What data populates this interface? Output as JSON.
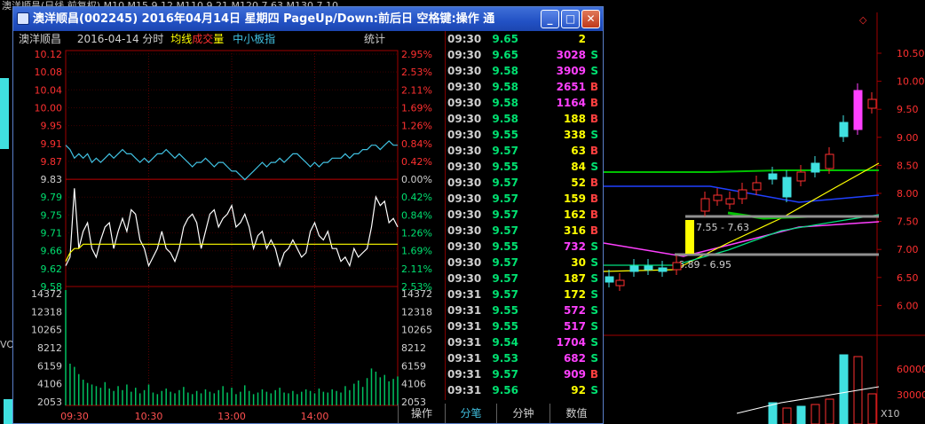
{
  "background_app": {
    "title_fragment": "澳洋顺昌(日线 前复权) M10  M15  9.12  M110  9.21  M120  7.63  M130  7.10",
    "vol_label": "VO",
    "price_axis": [
      "10.50",
      "10.00",
      "9.50",
      "9.00",
      "8.50",
      "8.00",
      "7.50",
      "7.00",
      "6.50",
      "6.00"
    ],
    "vol_axis": [
      "60000",
      "30000"
    ],
    "vol_scale": "X10",
    "annotation_high": "7.55 - 7.63",
    "annotation_low": "6.89 - 6.95",
    "diamond_icon": "diamond-icon"
  },
  "window": {
    "title": "澳洋顺昌(002245)  2016年04月14日  星期四  PageUp/Down:前后日  空格键:操作  通",
    "min_label": "_",
    "max_label": "□",
    "close_label": "✕"
  },
  "chart_header": {
    "stock_name": "澳洋顺昌",
    "date_label": "2016-04-14 分时",
    "avg_label": "均线",
    "volume_label": "成交量",
    "index_label": "中小板指",
    "stats_label": "统计"
  },
  "colors": {
    "up": "#ff3030",
    "down": "#00e070",
    "price_line": "#ffffff",
    "avg_line": "#ffff00",
    "index_line": "#40c0e0",
    "buy": "#ff4040",
    "sell": "#00e070",
    "neutral_volume": "#ffffff",
    "buy_volume_color": "#ff40ff"
  },
  "chart_data": {
    "type": "line",
    "title": "澳洋顺昌 2016-04-14 分时",
    "x_ticks": [
      "09:30",
      "10:30",
      "13:00",
      "14:00"
    ],
    "price_ticks": [
      "10.12",
      "10.08",
      "10.04",
      "10.00",
      "9.95",
      "9.91",
      "9.87",
      "9.83",
      "9.79",
      "9.75",
      "9.71",
      "9.66",
      "9.62",
      "9.58"
    ],
    "pct_ticks": [
      "2.95%",
      "2.53%",
      "2.11%",
      "1.69%",
      "1.26%",
      "0.84%",
      "0.42%",
      "0.00%",
      "0.42%",
      "0.84%",
      "1.26%",
      "1.69%",
      "2.11%",
      "2.53%"
    ],
    "prev_close": 9.83,
    "ylim": [
      9.58,
      10.12
    ],
    "volume_ticks": [
      "14372",
      "12318",
      "10265",
      "8212",
      "6159",
      "4106",
      "2053"
    ],
    "volume_ylim": [
      0,
      14372
    ],
    "series": [
      {
        "name": "价格",
        "color": "#ffffff",
        "values": [
          9.62,
          9.64,
          9.8,
          9.66,
          9.7,
          9.72,
          9.66,
          9.64,
          9.68,
          9.71,
          9.72,
          9.66,
          9.7,
          9.73,
          9.7,
          9.75,
          9.74,
          9.68,
          9.66,
          9.62,
          9.64,
          9.66,
          9.7,
          9.66,
          9.65,
          9.63,
          9.66,
          9.71,
          9.73,
          9.74,
          9.72,
          9.66,
          9.7,
          9.74,
          9.75,
          9.71,
          9.73,
          9.74,
          9.76,
          9.71,
          9.72,
          9.74,
          9.71,
          9.66,
          9.69,
          9.7,
          9.66,
          9.68,
          9.66,
          9.62,
          9.65,
          9.66,
          9.68,
          9.66,
          9.64,
          9.65,
          9.7,
          9.72,
          9.69,
          9.68,
          9.7,
          9.66,
          9.66,
          9.63,
          9.64,
          9.62,
          9.66,
          9.64,
          9.65,
          9.66,
          9.71,
          9.78,
          9.76,
          9.77,
          9.72,
          9.73,
          9.71
        ]
      },
      {
        "name": "均线",
        "color": "#ffff00",
        "values": [
          9.63,
          9.65,
          9.66,
          9.66,
          9.67,
          9.67,
          9.67,
          9.67,
          9.67,
          9.67,
          9.67,
          9.67,
          9.67,
          9.67,
          9.67,
          9.67,
          9.67,
          9.67,
          9.67,
          9.67,
          9.67,
          9.67,
          9.67,
          9.67,
          9.67,
          9.67,
          9.67,
          9.67,
          9.67,
          9.67,
          9.67,
          9.67,
          9.67,
          9.67,
          9.67,
          9.67,
          9.67,
          9.67,
          9.67,
          9.67,
          9.67,
          9.67,
          9.67,
          9.67,
          9.67,
          9.67,
          9.67,
          9.67,
          9.67,
          9.67,
          9.67,
          9.67,
          9.67,
          9.67,
          9.67,
          9.67,
          9.67,
          9.67,
          9.67,
          9.67,
          9.67,
          9.67,
          9.67,
          9.67,
          9.67,
          9.67,
          9.67,
          9.67,
          9.67,
          9.67,
          9.67,
          9.67,
          9.67,
          9.67,
          9.67,
          9.67,
          9.67
        ]
      },
      {
        "name": "中小板指",
        "color": "#40c0e0",
        "values": [
          9.9,
          9.89,
          9.87,
          9.88,
          9.87,
          9.88,
          9.86,
          9.87,
          9.86,
          9.87,
          9.88,
          9.87,
          9.88,
          9.89,
          9.88,
          9.88,
          9.87,
          9.86,
          9.87,
          9.86,
          9.87,
          9.88,
          9.88,
          9.89,
          9.88,
          9.87,
          9.88,
          9.87,
          9.86,
          9.85,
          9.86,
          9.86,
          9.87,
          9.86,
          9.85,
          9.86,
          9.86,
          9.85,
          9.84,
          9.84,
          9.83,
          9.82,
          9.83,
          9.84,
          9.85,
          9.86,
          9.85,
          9.86,
          9.86,
          9.87,
          9.86,
          9.87,
          9.88,
          9.88,
          9.87,
          9.86,
          9.85,
          9.86,
          9.85,
          9.86,
          9.86,
          9.87,
          9.87,
          9.87,
          9.88,
          9.87,
          9.88,
          9.88,
          9.89,
          9.89,
          9.9,
          9.9,
          9.89,
          9.9,
          9.91,
          9.9,
          9.9
        ]
      }
    ],
    "volume": [
      14372,
      5200,
      4800,
      3900,
      3200,
      2800,
      2600,
      2400,
      2200,
      2900,
      2100,
      1800,
      2400,
      1900,
      2600,
      1700,
      2200,
      1500,
      1900,
      2600,
      1600,
      1400,
      1800,
      2100,
      1700,
      1500,
      1900,
      2300,
      1600,
      1400,
      1800,
      1500,
      2000,
      1700,
      1500,
      1900,
      2400,
      1600,
      2200,
      1400,
      1700,
      2500,
      1800,
      1400,
      1600,
      2000,
      1700,
      1500,
      1900,
      2200,
      1600,
      1500,
      1800,
      1400,
      1700,
      2000,
      1800,
      1500,
      2100,
      1700,
      1600,
      2000,
      1800,
      1600,
      2400,
      1900,
      2700,
      3100,
      2300,
      3400,
      4600,
      4200,
      3500,
      3800,
      3000,
      3300,
      3600
    ]
  },
  "trade_list": [
    {
      "time": "09:30",
      "price": "9.65",
      "volume": "2",
      "side": "",
      "vcolor": "#ffff00"
    },
    {
      "time": "09:30",
      "price": "9.65",
      "volume": "3028",
      "side": "S",
      "vcolor": "#ff40ff"
    },
    {
      "time": "09:30",
      "price": "9.58",
      "volume": "3909",
      "side": "S",
      "vcolor": "#ff40ff"
    },
    {
      "time": "09:30",
      "price": "9.58",
      "volume": "2651",
      "side": "B",
      "vcolor": "#ff40ff"
    },
    {
      "time": "09:30",
      "price": "9.58",
      "volume": "1164",
      "side": "B",
      "vcolor": "#ff40ff"
    },
    {
      "time": "09:30",
      "price": "9.58",
      "volume": "188",
      "side": "B",
      "vcolor": "#ffff00"
    },
    {
      "time": "09:30",
      "price": "9.55",
      "volume": "338",
      "side": "S",
      "vcolor": "#ffff00"
    },
    {
      "time": "09:30",
      "price": "9.57",
      "volume": "63",
      "side": "B",
      "vcolor": "#ffff00"
    },
    {
      "time": "09:30",
      "price": "9.55",
      "volume": "84",
      "side": "S",
      "vcolor": "#ffff00"
    },
    {
      "time": "09:30",
      "price": "9.57",
      "volume": "52",
      "side": "B",
      "vcolor": "#ffff00"
    },
    {
      "time": "09:30",
      "price": "9.57",
      "volume": "159",
      "side": "B",
      "vcolor": "#ffff00"
    },
    {
      "time": "09:30",
      "price": "9.57",
      "volume": "162",
      "side": "B",
      "vcolor": "#ffff00"
    },
    {
      "time": "09:30",
      "price": "9.57",
      "volume": "316",
      "side": "B",
      "vcolor": "#ffff00"
    },
    {
      "time": "09:30",
      "price": "9.55",
      "volume": "732",
      "side": "S",
      "vcolor": "#ff40ff"
    },
    {
      "time": "09:30",
      "price": "9.57",
      "volume": "30",
      "side": "S",
      "vcolor": "#ffff00"
    },
    {
      "time": "09:30",
      "price": "9.57",
      "volume": "187",
      "side": "S",
      "vcolor": "#ffff00"
    },
    {
      "time": "09:31",
      "price": "9.57",
      "volume": "172",
      "side": "S",
      "vcolor": "#ffff00"
    },
    {
      "time": "09:31",
      "price": "9.55",
      "volume": "572",
      "side": "S",
      "vcolor": "#ff40ff"
    },
    {
      "time": "09:31",
      "price": "9.55",
      "volume": "517",
      "side": "S",
      "vcolor": "#ff40ff"
    },
    {
      "time": "09:31",
      "price": "9.54",
      "volume": "1704",
      "side": "S",
      "vcolor": "#ff40ff"
    },
    {
      "time": "09:31",
      "price": "9.53",
      "volume": "682",
      "side": "S",
      "vcolor": "#ff40ff"
    },
    {
      "time": "09:31",
      "price": "9.57",
      "volume": "909",
      "side": "B",
      "vcolor": "#ff40ff"
    },
    {
      "time": "09:31",
      "price": "9.56",
      "volume": "92",
      "side": "S",
      "vcolor": "#ffff00"
    }
  ],
  "tabs": [
    "操作",
    "分笔",
    "分钟",
    "数值"
  ]
}
